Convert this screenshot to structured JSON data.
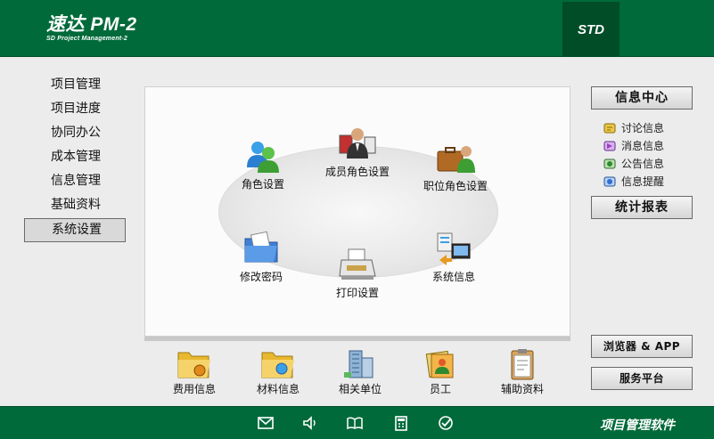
{
  "header": {
    "title": "速达 PM-2",
    "subtitle": "SD Project Management-2",
    "edition": "STD"
  },
  "nav": {
    "items": [
      {
        "label": "项目管理",
        "active": false
      },
      {
        "label": "项目进度",
        "active": false
      },
      {
        "label": "协同办公",
        "active": false
      },
      {
        "label": "成本管理",
        "active": false
      },
      {
        "label": "信息管理",
        "active": false
      },
      {
        "label": "基础资料",
        "active": false
      },
      {
        "label": "系统设置",
        "active": true
      }
    ]
  },
  "panel": {
    "tiles": {
      "role_settings": {
        "label": "角色设置",
        "icon": "users-icon"
      },
      "member_role_settings": {
        "label": "成员角色设置",
        "icon": "member-icon"
      },
      "position_role_settings": {
        "label": "职位角色设置",
        "icon": "briefcase-icon"
      },
      "change_password": {
        "label": "修改密码",
        "icon": "folder-icon"
      },
      "print_settings": {
        "label": "打印设置",
        "icon": "printer-icon"
      },
      "system_info": {
        "label": "系统信息",
        "icon": "monitor-icon"
      }
    }
  },
  "right": {
    "info_center": "信息中心",
    "info_items": [
      {
        "label": "讨论信息",
        "icon": "discussion-icon",
        "color": "#d9a400"
      },
      {
        "label": "消息信息",
        "icon": "message-icon",
        "color": "#9b3fc4"
      },
      {
        "label": "公告信息",
        "icon": "notice-icon",
        "color": "#2f8a2f"
      },
      {
        "label": "信息提醒",
        "icon": "reminder-icon",
        "color": "#2f6fd0"
      }
    ],
    "stats_report": "统计报表",
    "browser_app": "浏览器 & APP",
    "service_platform": "服务平台"
  },
  "bottom": {
    "tiles": [
      {
        "label": "费用信息",
        "icon": "fee-folder-icon"
      },
      {
        "label": "材料信息",
        "icon": "material-folder-icon"
      },
      {
        "label": "相关单位",
        "icon": "building-icon"
      },
      {
        "label": "员工",
        "icon": "staff-icon"
      },
      {
        "label": "辅助资料",
        "icon": "clipboard-icon"
      }
    ]
  },
  "footer": {
    "title": "项目管理软件",
    "icons": [
      "mail-icon",
      "speaker-icon",
      "book-icon",
      "calculator-icon",
      "check-circle-icon"
    ]
  },
  "colors": {
    "brand_green": "#006a3a",
    "brand_dark": "#004d28"
  }
}
